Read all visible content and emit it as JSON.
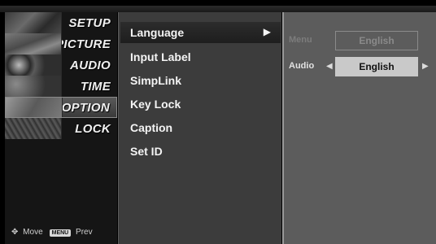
{
  "categories": [
    {
      "label": "SETUP",
      "icon": "setup-thumbnail-icon"
    },
    {
      "label": "PICTURE",
      "icon": "picture-thumbnail-icon"
    },
    {
      "label": "AUDIO",
      "icon": "audio-thumbnail-icon"
    },
    {
      "label": "TIME",
      "icon": "time-thumbnail-icon"
    },
    {
      "label": "OPTION",
      "icon": "option-thumbnail-icon",
      "selected": true
    },
    {
      "label": "LOCK",
      "icon": "lock-thumbnail-icon"
    }
  ],
  "footer": {
    "move_label": "Move",
    "menu_key": "MENU",
    "prev_label": "Prev"
  },
  "menu_items": [
    {
      "label": "Language",
      "selected": true
    },
    {
      "label": "Input Label"
    },
    {
      "label": "SimpLink"
    },
    {
      "label": "Key Lock"
    },
    {
      "label": "Caption"
    },
    {
      "label": "Set ID"
    }
  ],
  "submenu_arrow": "▶",
  "language_options": {
    "menu": {
      "label": "Menu",
      "value": "English"
    },
    "audio": {
      "label": "Audio",
      "value": "English"
    }
  },
  "colors": {
    "background": "#000000",
    "panel_middle": "#3c3c3c",
    "panel_right": "#5c5c5c",
    "highlight": "#c9c9c9"
  }
}
